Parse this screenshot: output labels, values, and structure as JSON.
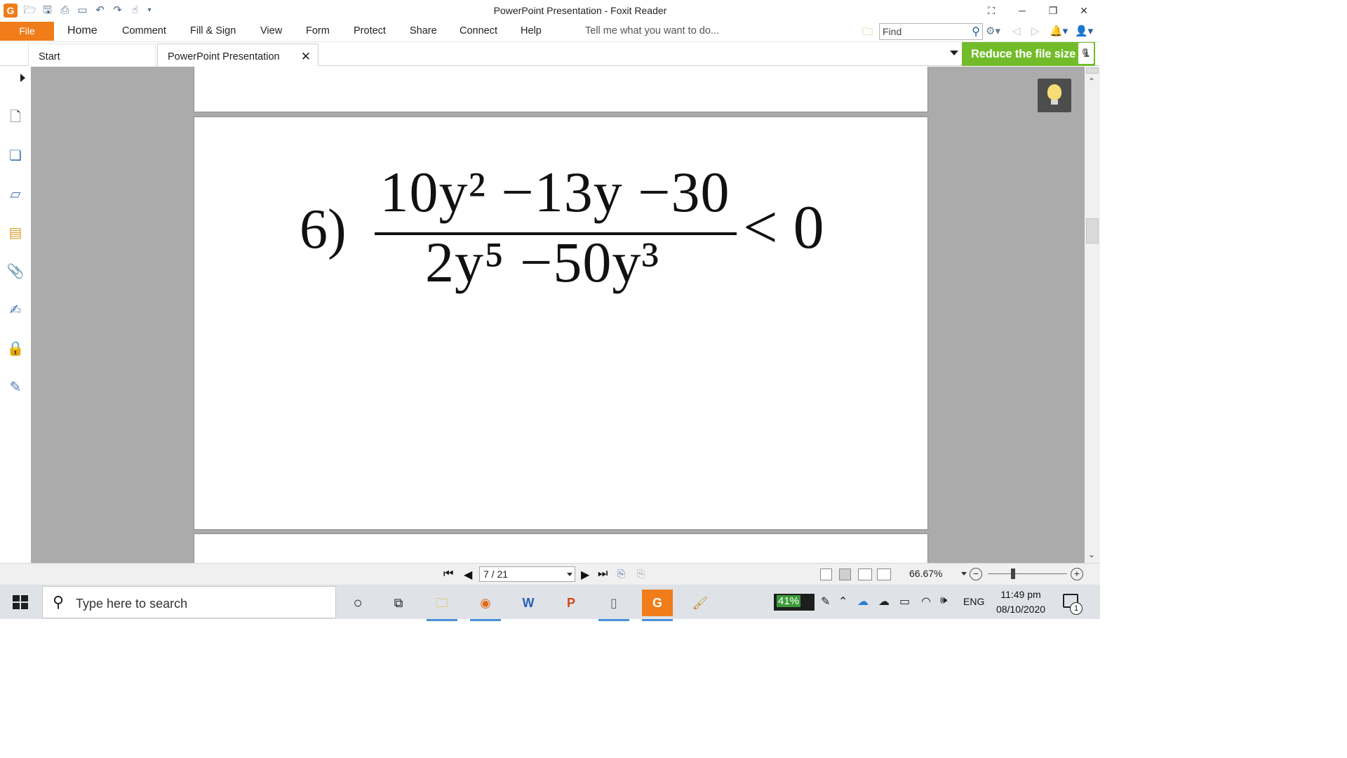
{
  "window": {
    "title": "PowerPoint Presentation - Foxit Reader"
  },
  "menu": {
    "file": "File",
    "items": [
      "Home",
      "Comment",
      "Fill & Sign",
      "View",
      "Form",
      "Protect",
      "Share",
      "Connect",
      "Help"
    ],
    "tell_me": "Tell me what you want to do...",
    "find_placeholder": "Find"
  },
  "tabs": {
    "start": "Start",
    "document": "PowerPoint Presentation",
    "close": "✕"
  },
  "banner": {
    "reduce": "Reduce the file size"
  },
  "page_content": {
    "label": "6)",
    "numerator": "10y² −13y −30",
    "denominator": "2y⁵ −50y³",
    "relation": "< 0"
  },
  "statusbar": {
    "page_indicator": "7 / 21",
    "zoom": "66.67%"
  },
  "taskbar": {
    "search_placeholder": "Type here to search",
    "battery": "41%",
    "language": "ENG",
    "time": "11:49 pm",
    "date": "08/10/2020",
    "notification_count": "1"
  },
  "colors": {
    "accent": "#f07c1a",
    "banner_green": "#72bc2a",
    "doc_background": "#ababab"
  }
}
